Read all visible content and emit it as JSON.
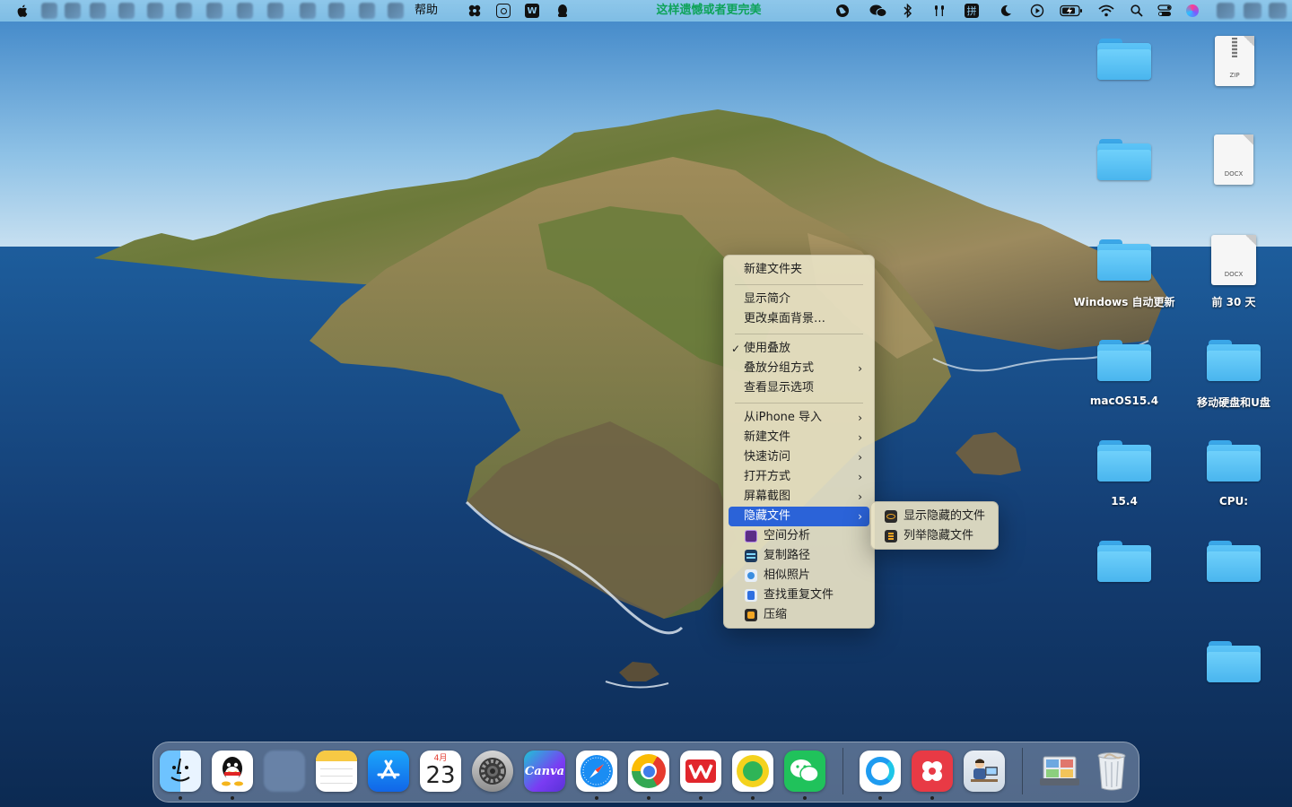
{
  "menubar": {
    "help_label": "帮助",
    "promo_text": "这样遗憾或者更完美",
    "icons": [
      "apple-logo-icon",
      "pinwheel-icon",
      "qq-browser-icon",
      "wps-icon",
      "qq-icon",
      "globe-icon",
      "wechat-icon",
      "bluetooth-icon",
      "airpods-icon",
      "input-method-pin-icon",
      "moon-icon",
      "play-icon",
      "battery-charging-icon",
      "wifi-icon",
      "search-icon",
      "control-center-icon",
      "siri-icon"
    ],
    "input_method_label": "拼"
  },
  "context_menu": {
    "items": [
      {
        "label": "新建文件夹"
      },
      {
        "label": "显示简介"
      },
      {
        "label": "更改桌面背景…"
      },
      {
        "label": "使用叠放",
        "checked": true
      },
      {
        "label": "叠放分组方式",
        "submenu": true
      },
      {
        "label": "查看显示选项"
      },
      {
        "label": "从iPhone 导入",
        "submenu": true
      },
      {
        "label": "新建文件",
        "submenu": true
      },
      {
        "label": "快速访问",
        "submenu": true
      },
      {
        "label": "打开方式",
        "submenu": true
      },
      {
        "label": "屏幕截图",
        "submenu": true
      },
      {
        "label": "隐藏文件",
        "submenu": true,
        "selected": true
      },
      {
        "label": "空间分析",
        "icon": "space-analysis-icon"
      },
      {
        "label": "复制路径",
        "icon": "copy-path-icon"
      },
      {
        "label": "相似照片",
        "icon": "similar-photos-icon"
      },
      {
        "label": "查找重复文件",
        "icon": "duplicate-finder-icon"
      },
      {
        "label": "压缩",
        "icon": "compress-icon"
      }
    ],
    "check_mark": "✓",
    "chevron": "›"
  },
  "submenu": {
    "items": [
      {
        "label": "显示隐藏的文件",
        "icon": "eye-icon"
      },
      {
        "label": "列举隐藏文件",
        "icon": "list-icon"
      }
    ]
  },
  "desktop": {
    "icons": [
      {
        "type": "folder",
        "label": ""
      },
      {
        "type": "zip",
        "label": "",
        "badge": "ZIP"
      },
      {
        "type": "folder",
        "label": ""
      },
      {
        "type": "docx",
        "label": "",
        "badge": "DOCX"
      },
      {
        "type": "folder",
        "label": "Windows 自动更新"
      },
      {
        "type": "docx",
        "label": "前 30 天",
        "badge": "DOCX"
      },
      {
        "type": "folder",
        "label": "macOS15.4"
      },
      {
        "type": "folder",
        "label": "移动硬盘和U盘"
      },
      {
        "type": "folder",
        "label": "15.4"
      },
      {
        "type": "folder",
        "label": "CPU:"
      },
      {
        "type": "folder",
        "label": ""
      },
      {
        "type": "folder",
        "label": ""
      },
      {
        "type": "folder",
        "label": ""
      }
    ]
  },
  "dock": {
    "apps": [
      {
        "name": "Finder",
        "icon": "finder-icon",
        "running": true
      },
      {
        "name": "QQ",
        "icon": "qq-icon",
        "running": true
      },
      {
        "name": "Blank",
        "icon": "blank-app-icon",
        "running": false
      },
      {
        "name": "Notes",
        "icon": "notes-icon",
        "running": false
      },
      {
        "name": "App Store",
        "icon": "app-store-icon",
        "running": false
      },
      {
        "name": "Calendar",
        "icon": "calendar-icon",
        "running": false,
        "month": "4月",
        "day": "23"
      },
      {
        "name": "System Settings",
        "icon": "settings-gear-icon",
        "running": false
      },
      {
        "name": "Canva",
        "icon": "canva-icon",
        "running": false,
        "text": "Canva"
      },
      {
        "name": "Safari",
        "icon": "safari-icon",
        "running": true
      },
      {
        "name": "Chrome",
        "icon": "chrome-icon",
        "running": true
      },
      {
        "name": "WPS",
        "icon": "wps-icon",
        "running": true
      },
      {
        "name": "QQ Music",
        "icon": "qq-music-icon",
        "running": true
      },
      {
        "name": "WeChat",
        "icon": "wechat-icon",
        "running": true
      },
      {
        "name": "QQ Browser",
        "icon": "qq-browser-icon",
        "running": true
      },
      {
        "name": "Pinwheel",
        "icon": "pinwheel-icon",
        "running": true
      },
      {
        "name": "Preview User",
        "icon": "person-at-desk-icon",
        "running": false
      },
      {
        "name": "Screenshots",
        "icon": "screenshot-folder-icon",
        "running": false
      },
      {
        "name": "Trash",
        "icon": "trash-icon",
        "running": false
      }
    ]
  },
  "colors": {
    "menubar": "#8ec7ea",
    "menu_bg": "#e8e2c4",
    "selection": "#2b63d8",
    "folder": "#49b5ee",
    "promo_green": "#0ea35a"
  }
}
